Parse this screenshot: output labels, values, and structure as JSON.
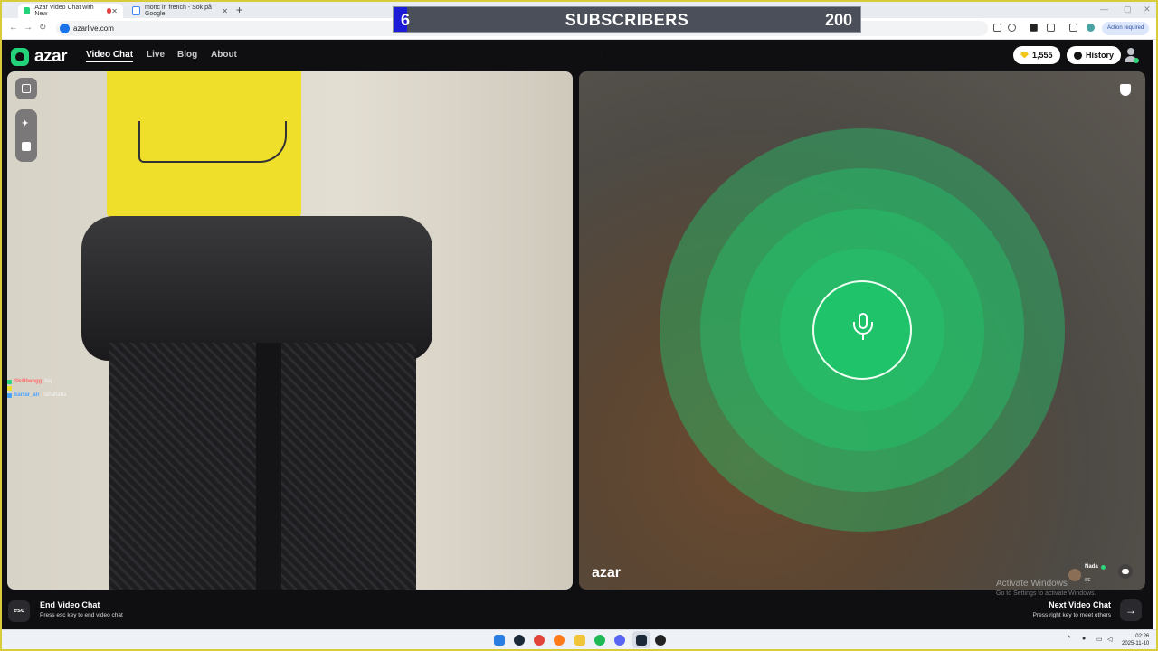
{
  "browser": {
    "tabs": [
      {
        "title": "Azar Video Chat with New",
        "active": true
      },
      {
        "title": "monc in french - Sök på Google",
        "active": false
      }
    ],
    "new_tab_label": "+",
    "url": "azarlive.com",
    "action_required": "Action required"
  },
  "subscribers": {
    "current": "6",
    "label": "SUBSCRIBERS",
    "goal": "200",
    "progress_fraction": 0.03
  },
  "app": {
    "logo": "azar",
    "nav": [
      "Video Chat",
      "Live",
      "Blog",
      "About"
    ],
    "gems": "1,555",
    "history_label": "History",
    "accent_color": "#22d37a"
  },
  "chat_overlay": [
    {
      "user": "Skillbengg",
      "text": "hej",
      "color": "#ff6b6b"
    },
    {
      "user": "",
      "text": "",
      "color": "#f0df2a"
    },
    {
      "user": "karrar_air",
      "text": "hahahaha",
      "color": "#4aa3ff"
    }
  ],
  "remote": {
    "watermark": "azar",
    "peer_name": "Nada",
    "peer_country": "SE"
  },
  "footer": {
    "esc_key": "esc",
    "end_title": "End Video Chat",
    "end_sub": "Press esc key to end video chat",
    "next_title": "Next Video Chat",
    "next_sub": "Press right key to meet others",
    "next_arrow": "→"
  },
  "windows": {
    "activate_title": "Activate Windows",
    "activate_sub": "Go to Settings to activate Windows."
  },
  "taskbar": {
    "time": "02:26",
    "date": "2025-11-10"
  }
}
